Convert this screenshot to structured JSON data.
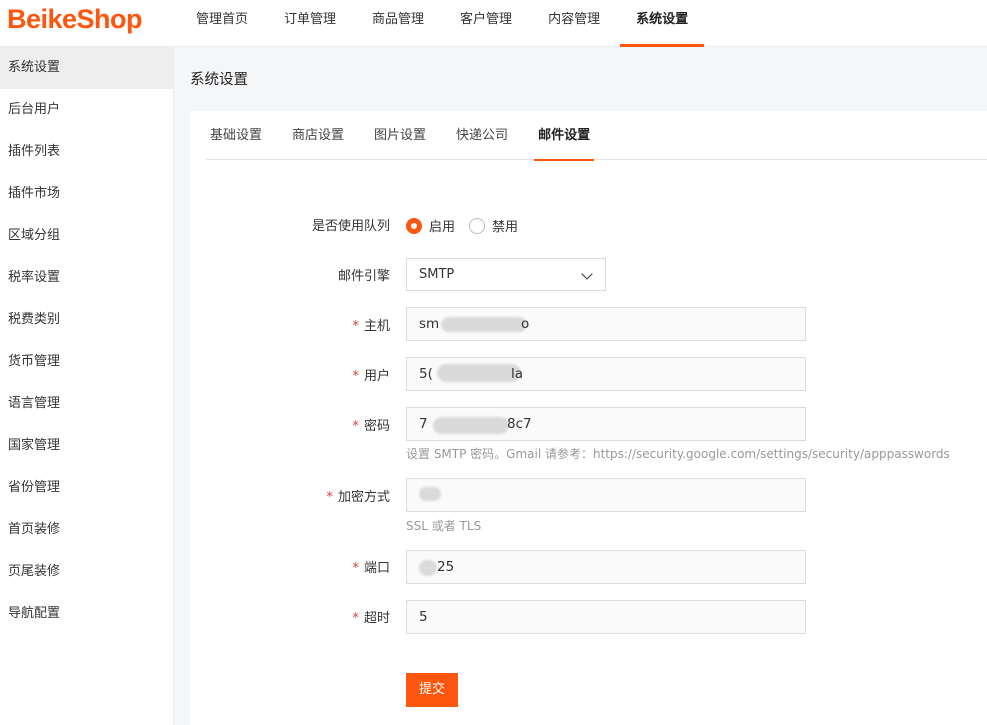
{
  "brand": {
    "logo": "BeikeShop",
    "accent": "#fd560f"
  },
  "topnav": {
    "items": [
      {
        "label": "管理首页"
      },
      {
        "label": "订单管理"
      },
      {
        "label": "商品管理"
      },
      {
        "label": "客户管理"
      },
      {
        "label": "内容管理"
      },
      {
        "label": "系统设置",
        "active": true
      }
    ]
  },
  "sidebar": {
    "items": [
      {
        "label": "系统设置",
        "active": true
      },
      {
        "label": "后台用户"
      },
      {
        "label": "插件列表"
      },
      {
        "label": "插件市场"
      },
      {
        "label": "区域分组"
      },
      {
        "label": "税率设置"
      },
      {
        "label": "税费类别"
      },
      {
        "label": "货币管理"
      },
      {
        "label": "语言管理"
      },
      {
        "label": "国家管理"
      },
      {
        "label": "省份管理"
      },
      {
        "label": "首页装修"
      },
      {
        "label": "页尾装修"
      },
      {
        "label": "导航配置"
      }
    ]
  },
  "page": {
    "title": "系统设置"
  },
  "tabs": {
    "items": [
      {
        "label": "基础设置"
      },
      {
        "label": "商店设置"
      },
      {
        "label": "图片设置"
      },
      {
        "label": "快递公司"
      },
      {
        "label": "邮件设置",
        "active": true
      }
    ]
  },
  "form": {
    "queue": {
      "label": "是否使用队列",
      "option_on": "启用",
      "option_off": "禁用",
      "selected": "启用"
    },
    "engine": {
      "label": "邮件引擎",
      "value": "SMTP"
    },
    "host": {
      "label": "主机",
      "required": true,
      "value_start": "sm",
      "value_end": "o"
    },
    "user": {
      "label": "用户",
      "required": true,
      "value_start": "5(",
      "value_end": "la"
    },
    "password": {
      "label": "密码",
      "required": true,
      "value_start": "7",
      "value_end": "8c7",
      "help": "设置 SMTP 密码。Gmail 请参考：https://security.google.com/settings/security/apppasswords"
    },
    "encryption": {
      "label": "加密方式",
      "required": true,
      "value": "",
      "help": "SSL 或者 TLS"
    },
    "port": {
      "label": "端口",
      "required": true,
      "value_end": "25"
    },
    "timeout": {
      "label": "超时",
      "required": true,
      "value": "5"
    },
    "submit_label": "提交"
  }
}
